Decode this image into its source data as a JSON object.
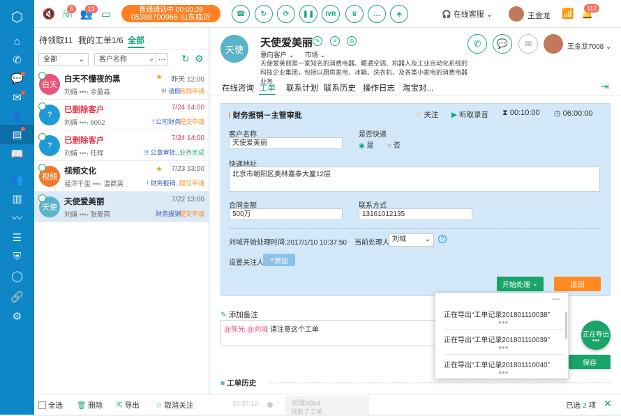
{
  "rail": {
    "icons": [
      "logo-icon",
      "home-icon",
      "phone-icon",
      "chat-icon",
      "mail-icon",
      "contacts-icon",
      "workorder-icon",
      "book-icon",
      "user-group-icon",
      "chart-icon",
      "monitor-icon",
      "list-icon",
      "shield-icon",
      "comment-icon",
      "link-icon",
      "settings-icon"
    ]
  },
  "top": {
    "badge_missed": "5",
    "badge_contacts": "12",
    "call_line1": "普通通话中  00:00:28",
    "call_line2": "05398700966 山东临沂",
    "ivr": "IVR",
    "online": "在线客服",
    "user": "王金龙",
    "notif": "112"
  },
  "left": {
    "tab_pending": "待领取11",
    "tab_mine": "我的工单1/6",
    "tab_all": "全部",
    "filter_all": "全部",
    "filter_field": "客户名称",
    "items": [
      {
        "avatar": "白天",
        "avatar_color": "#e8547a",
        "name": "白天不懂夜的黑",
        "name_red": false,
        "star": true,
        "time": "昨天 12:00",
        "from": "刘婧",
        "to": "余盈淼",
        "tag": "!!! 请假",
        "status": "合同申请",
        "status_color": "#ff8a1f"
      },
      {
        "avatar": "?",
        "avatar_color": "#1f9ad6",
        "name": "已删除客户",
        "name_red": true,
        "star": false,
        "time": "7/24 14:00",
        "from": "刘婧",
        "to": "8002",
        "tag": "! 公司财务",
        "status": "提交申请",
        "status_color": "#ff8a1f"
      },
      {
        "avatar": "?",
        "avatar_color": "#1f9ad6",
        "name": "已删除客户",
        "name_red": true,
        "star": false,
        "time": "7/24 14:00",
        "from": "刘婧",
        "to": "任晖",
        "tag": "!!! 公章审批...",
        "status": "业务完成",
        "status_color": "#19a85c"
      },
      {
        "avatar": "视频",
        "avatar_color": "#f07a2a",
        "name": "视频文化",
        "name_red": false,
        "star": true,
        "time": "7/23 13:00",
        "from": "易洋千玺",
        "to": "温群英",
        "tag": "! 财务报销...",
        "status": "提交申请",
        "status_color": "#ff8a1f"
      },
      {
        "avatar": "天使",
        "avatar_color": "#5ab3c9",
        "name": "天使爱美丽",
        "name_red": false,
        "star": false,
        "time": "7/22 13:00",
        "from": "刘婧",
        "to": "张筱雨",
        "tag": "财务报销",
        "status": "提交申请",
        "status_color": "#ff8a1f"
      }
    ]
  },
  "customer": {
    "avatar": "天使",
    "name": "天使爱美丽",
    "intent": "意向客户",
    "market": "市场",
    "desc": "天使爱美丽是一家知名的消费电器、暖通空调、机器人及工业自动化系统的科技企业集团，包括以厨房家电、冰箱、洗衣机、及各类小家电的消费电器业务",
    "agent": "王金龙7008"
  },
  "tabs": [
    "在线咨询",
    "工单",
    "联系计划",
    "联系历史",
    "操作日志",
    "淘宝对..."
  ],
  "form": {
    "title": "财务报销－主管审批",
    "follow": "关注",
    "listen": "听取录音",
    "t1": "00:10:00",
    "t2": "06:00:00",
    "customer_label": "客户名称",
    "customer_value": "天使爱美丽",
    "express_label": "是否快递",
    "yes": "是",
    "no": "否",
    "address_label": "快递地址",
    "address_value": "北京市朝阳区奥林嘉泰大厦12层",
    "amount_label": "合同金额",
    "amount_value": "500万",
    "contact_label": "联系方式",
    "contact_value": "13161012135",
    "start_time": "刘域开始处理时间:2017/1/10  10:37:50",
    "handler_label": "当前处理人",
    "handler_value": "刘域",
    "follower_label": "设置关注人",
    "add": "添加",
    "start_btn": "开始处理",
    "back_btn": "退回"
  },
  "note": {
    "label": "添加备注",
    "mention1": "@陈光",
    "mention2": "@刘域",
    "text": "请注意这个工单",
    "save": "保存"
  },
  "history": {
    "label": "工单历史"
  },
  "exports": [
    "正在导出“工单记录201801110038”",
    "正在导出“工单记录201801110039”",
    "正在导出“工单记录201801110040”"
  ],
  "exporting_bubble": "正在导出",
  "bottom": {
    "select_all": "全选",
    "delete": "删除",
    "export": "导出",
    "unfollow": "取消关注",
    "time": "10:37:12",
    "hist_user": "刘域8004",
    "hist_action": "领取了工单",
    "selected_pre": "已选",
    "selected_n": "2",
    "selected_post": "项"
  }
}
